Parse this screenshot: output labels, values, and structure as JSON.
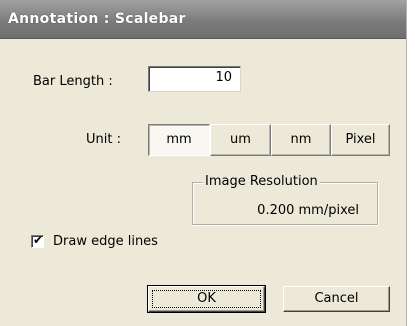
{
  "dialog": {
    "title": "Annotation : Scalebar"
  },
  "bar_length": {
    "label": "Bar Length  :",
    "value": "10"
  },
  "unit": {
    "label": "Unit :",
    "options": [
      "mm",
      "um",
      "nm",
      "Pixel"
    ],
    "selected": "mm"
  },
  "image_resolution": {
    "legend": "Image Resolution",
    "value": "0.200  mm/pixel"
  },
  "draw_edge_lines": {
    "label": "Draw edge lines",
    "checked": true,
    "check_glyph": "✔"
  },
  "buttons": {
    "ok": "OK",
    "cancel": "Cancel"
  }
}
